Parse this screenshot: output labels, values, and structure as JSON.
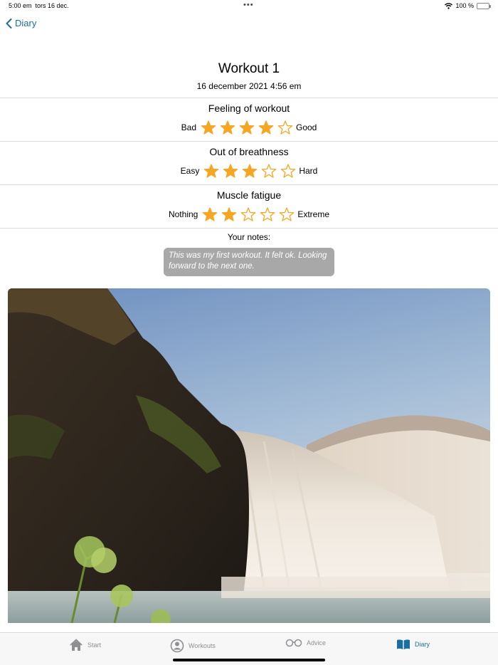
{
  "status_bar": {
    "time": "5:00 em",
    "date": "tors 16 dec.",
    "dots": "•••",
    "battery": "100 %"
  },
  "nav": {
    "back_label": "Diary"
  },
  "workout": {
    "title": "Workout 1",
    "date": "16 december 2021 4:56 em"
  },
  "ratings": [
    {
      "title": "Feeling of workout",
      "low_label": "Bad",
      "high_label": "Good",
      "value": 4,
      "max": 5
    },
    {
      "title": "Out of breathness",
      "low_label": "Easy",
      "high_label": "Hard",
      "value": 3,
      "max": 5
    },
    {
      "title": "Muscle fatigue",
      "low_label": "Nothing",
      "high_label": "Extreme",
      "value": 2,
      "max": 5
    }
  ],
  "notes": {
    "label": "Your notes:",
    "text": "This was my first workout. It felt ok. Looking forward to the next one."
  },
  "tabs": [
    {
      "label": "Start",
      "icon": "house-icon",
      "active": false
    },
    {
      "label": "Workouts",
      "icon": "person-circle-icon",
      "active": false
    },
    {
      "label": "Advice",
      "icon": "glasses-icon",
      "active": false
    },
    {
      "label": "Diary",
      "icon": "book-icon",
      "active": true
    }
  ],
  "colors": {
    "accent": "#1a6fa0",
    "star": "#f6a623",
    "notes_bg": "#a8a8a8"
  }
}
